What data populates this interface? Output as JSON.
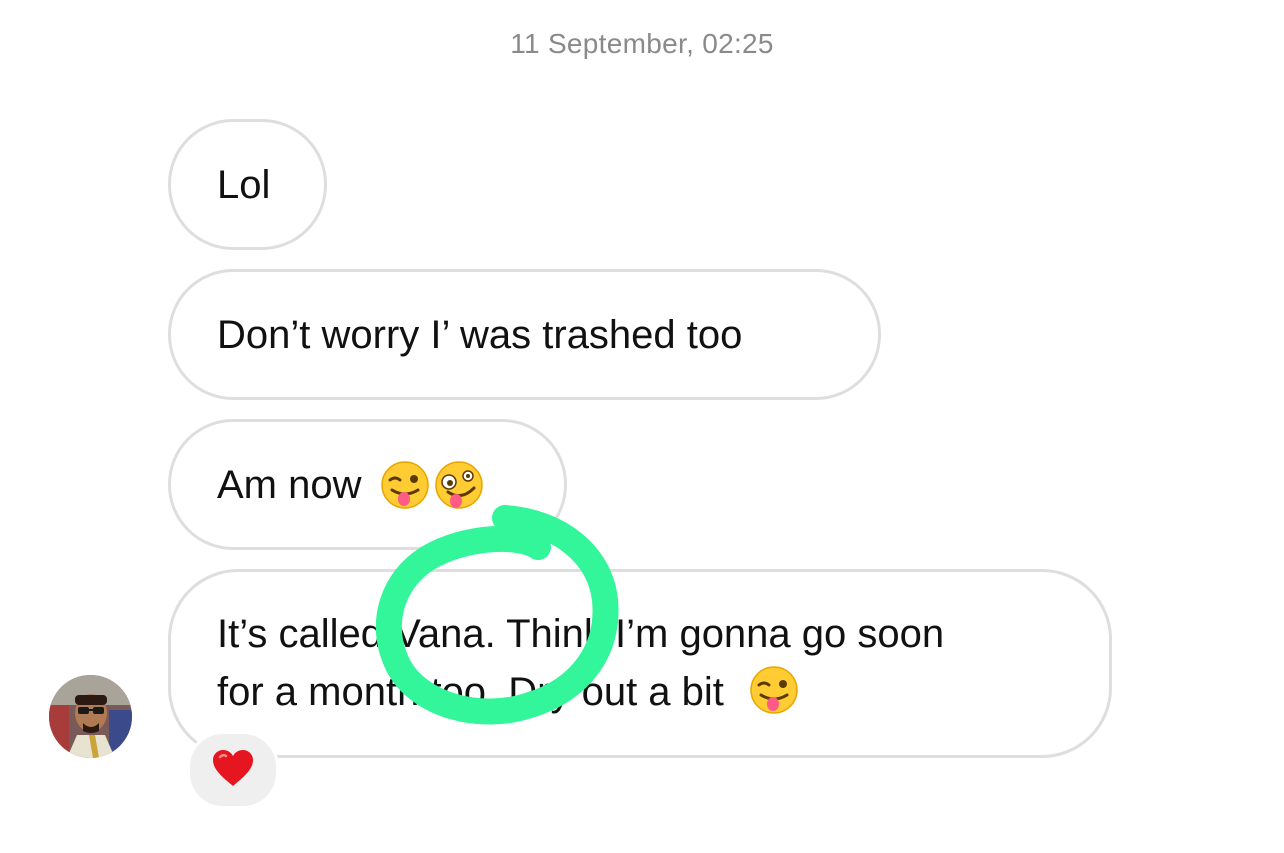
{
  "conversation": {
    "timestamp": "11 September, 02:25",
    "messages": [
      {
        "text": "Lol"
      },
      {
        "text": "Don’t worry I’ was trashed too"
      },
      {
        "text": "Am now",
        "emojis": [
          "winking-face-with-tongue-icon",
          "zany-face-icon"
        ]
      },
      {
        "line1": "It’s called Vana. Think I’m gonna go soon",
        "line2": "for a month too. Dry out a bit",
        "emojis": [
          "winking-face-with-tongue-icon"
        ],
        "reaction": "heart-icon"
      }
    ]
  },
  "annotation": {
    "type": "hand-drawn circle",
    "color": "#33f59a"
  }
}
